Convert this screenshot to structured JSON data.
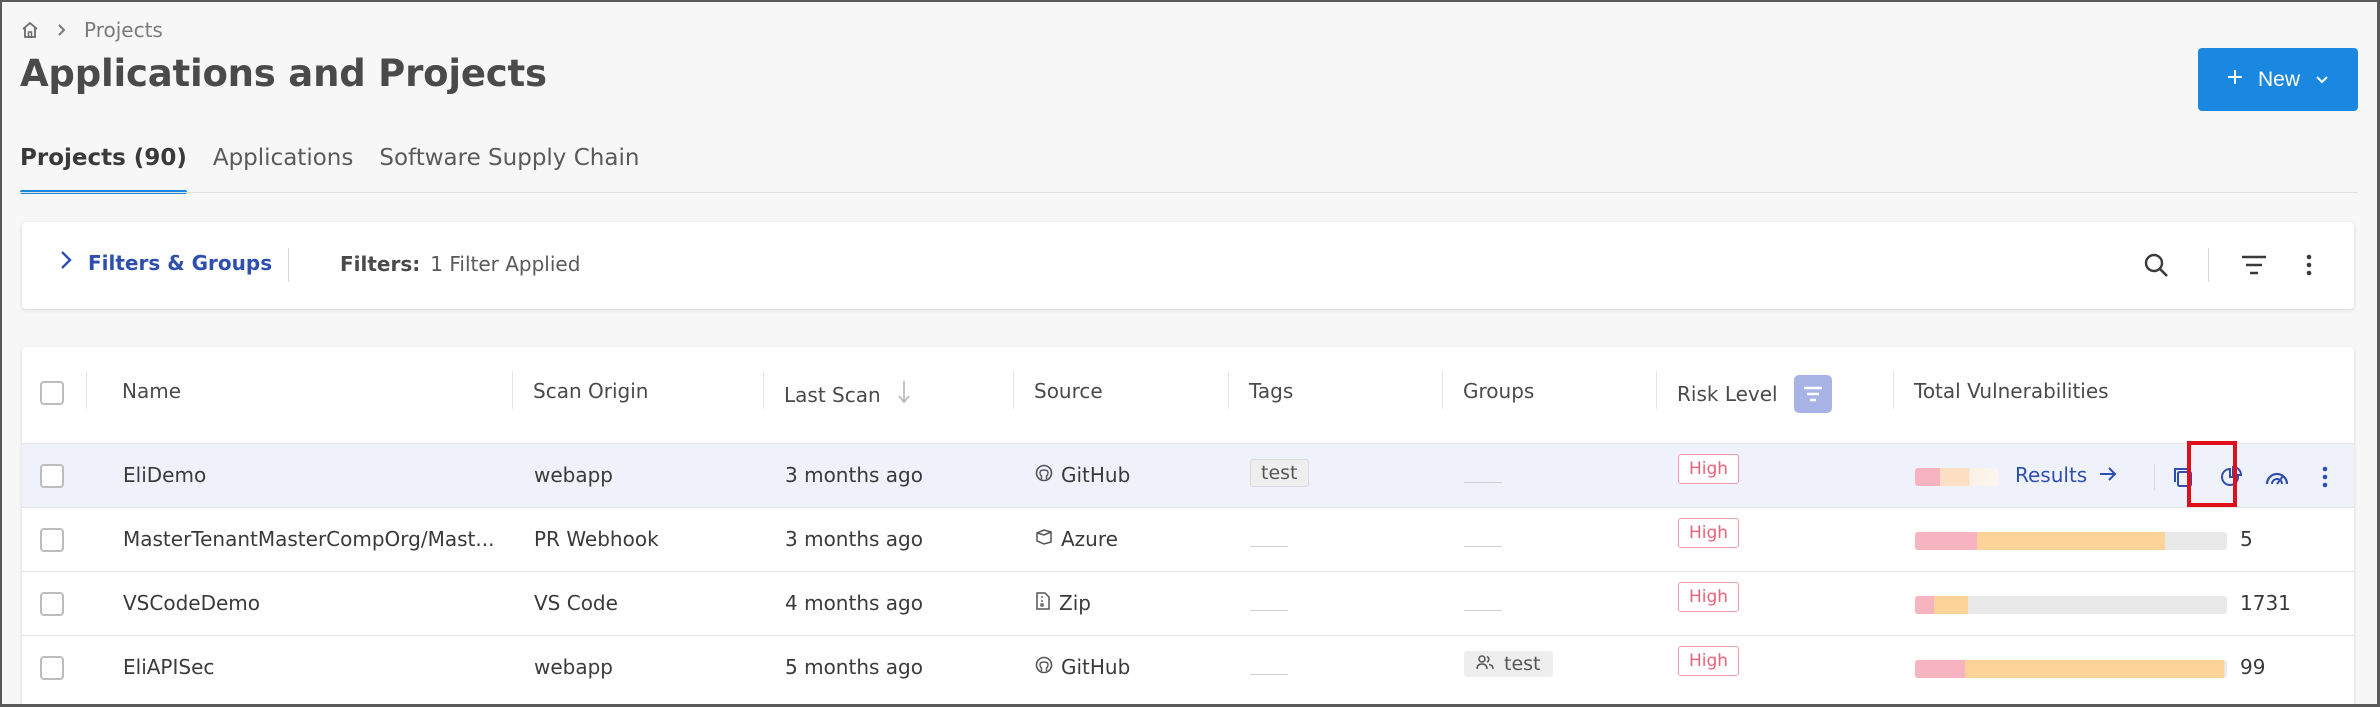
{
  "breadcrumb": {
    "home_icon": "home-icon",
    "separator_icon": "chevron-right-icon",
    "current": "Projects"
  },
  "page": {
    "title": "Applications and Projects"
  },
  "new_button": {
    "label": "New",
    "plus_icon": "plus-icon",
    "chevron_icon": "chevron-down-icon",
    "color": "#1a88e0"
  },
  "tabs": [
    {
      "label": "Projects (90)",
      "active": true
    },
    {
      "label": "Applications",
      "active": false
    },
    {
      "label": "Software Supply Chain",
      "active": false
    }
  ],
  "filter_bar": {
    "toggle_label": "Filters & Groups",
    "summary_label": "Filters:",
    "summary_value": "1 Filter Applied",
    "icons": [
      "search-icon",
      "filter-lines-icon",
      "kebab-menu-icon"
    ]
  },
  "table": {
    "columns": [
      "Name",
      "Scan Origin",
      "Last Scan",
      "Source",
      "Tags",
      "Groups",
      "Risk Level",
      "Total Vulnerabilities"
    ],
    "rows": [
      {
        "name": "EliDemo",
        "scan_origin": "webapp",
        "last_scan": "3 months ago",
        "source": "GitHub",
        "source_icon": "github-icon",
        "tag": "test",
        "group": "",
        "risk": "High",
        "high_pct": 8,
        "medium_pct": 10,
        "total": "",
        "results_label": "Results",
        "hovered": true
      },
      {
        "name": "MasterTenantMasterCompOrg/Mast...",
        "scan_origin": "PR Webhook",
        "last_scan": "3 months ago",
        "source": "Azure",
        "source_icon": "azure-icon",
        "tag": "",
        "group": "",
        "risk": "High",
        "high_pct": 20,
        "medium_pct": 60,
        "total": "5",
        "hovered": false
      },
      {
        "name": "VSCodeDemo",
        "scan_origin": "VS Code",
        "last_scan": "4 months ago",
        "source": "Zip",
        "source_icon": "zip-icon",
        "tag": "",
        "group": "",
        "risk": "High",
        "high_pct": 6,
        "medium_pct": 11,
        "total": "1731",
        "hovered": false
      },
      {
        "name": "EliAPISec",
        "scan_origin": "webapp",
        "last_scan": "5 months ago",
        "source": "GitHub",
        "source_icon": "github-icon",
        "tag": "",
        "group": "test",
        "risk": "High",
        "high_pct": 16,
        "medium_pct": 83,
        "total": "99",
        "hovered": false
      }
    ]
  },
  "colors": {
    "high": "#f7b3c0",
    "medium": "#fdd39a",
    "empty": "#e8e8e8",
    "link": "#2f4fb0",
    "highlight": "#e0101a"
  }
}
